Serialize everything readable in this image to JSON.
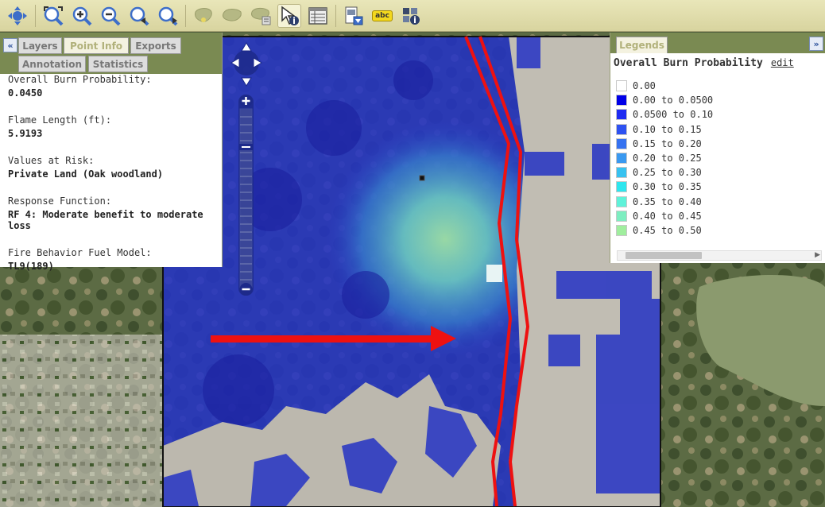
{
  "toolbar": {
    "buttons": [
      {
        "name": "pan-tool-button",
        "icon": "pan-icon"
      },
      {
        "name": "full-extent-button",
        "icon": "full-extent-icon"
      },
      {
        "name": "zoom-in-button",
        "icon": "zoom-in-icon"
      },
      {
        "name": "zoom-out-button",
        "icon": "zoom-out-icon"
      },
      {
        "name": "previous-extent-button",
        "icon": "previous-extent-icon"
      },
      {
        "name": "next-extent-button",
        "icon": "next-extent-icon"
      },
      {
        "name": "select-area-button",
        "icon": "select-area-icon"
      },
      {
        "name": "select-area-2-button",
        "icon": "select-area-2-icon"
      },
      {
        "name": "area-stats-button",
        "icon": "area-stats-icon"
      },
      {
        "name": "point-info-tool-button",
        "icon": "identify-pointer-icon"
      },
      {
        "name": "attribute-table-button",
        "icon": "table-icon"
      },
      {
        "name": "export-map-button",
        "icon": "export-icon"
      },
      {
        "name": "label-button",
        "icon": "label-icon"
      },
      {
        "name": "legend-info-button",
        "icon": "grid-info-icon"
      }
    ],
    "label_button_text": "abc"
  },
  "left_panel": {
    "collapse_glyph": "«",
    "tabs": [
      "Layers",
      "Point Info",
      "Exports",
      "Annotation",
      "Statistics"
    ],
    "active_tab": "Point Info",
    "fields": [
      {
        "label": "Overall Burn Probability:",
        "value": "0.0450"
      },
      {
        "label": "Flame Length (ft):",
        "value": "5.9193"
      },
      {
        "label": "Values at Risk:",
        "value": "Private Land (Oak woodland)"
      },
      {
        "label": "Response Function:",
        "value": "RF 4: Moderate benefit to moderate loss"
      },
      {
        "label": "Fire Behavior Fuel Model:",
        "value": "TL9(189)"
      }
    ]
  },
  "legend_panel": {
    "tab": "Legends",
    "expand_glyph": "»",
    "title": "Overall Burn Probability",
    "edit_label": "edit",
    "items": [
      {
        "label": "0.00",
        "color": "#ffffff"
      },
      {
        "label": "0.00 to 0.0500",
        "color": "#0000e8"
      },
      {
        "label": "0.0500 to 0.10",
        "color": "#1f2cf2"
      },
      {
        "label": "0.10 to 0.15",
        "color": "#2e52f2"
      },
      {
        "label": "0.15 to 0.20",
        "color": "#3572f0"
      },
      {
        "label": "0.20 to 0.25",
        "color": "#3a99f0"
      },
      {
        "label": "0.25 to 0.30",
        "color": "#37c2f0"
      },
      {
        "label": "0.30 to 0.35",
        "color": "#2ee6ee"
      },
      {
        "label": "0.35 to 0.40",
        "color": "#5ff2d9"
      },
      {
        "label": "0.40 to 0.45",
        "color": "#7deec0"
      },
      {
        "label": "0.45 to 0.50",
        "color": "#a0ee9e"
      }
    ]
  },
  "map": {
    "colors": {
      "burn_low": "#1e28c8",
      "burn_mid": "#3aa6c6",
      "burn_high": "#86d8b2",
      "developed": "#bfbab0",
      "annotation_red": "#ee1111"
    }
  }
}
